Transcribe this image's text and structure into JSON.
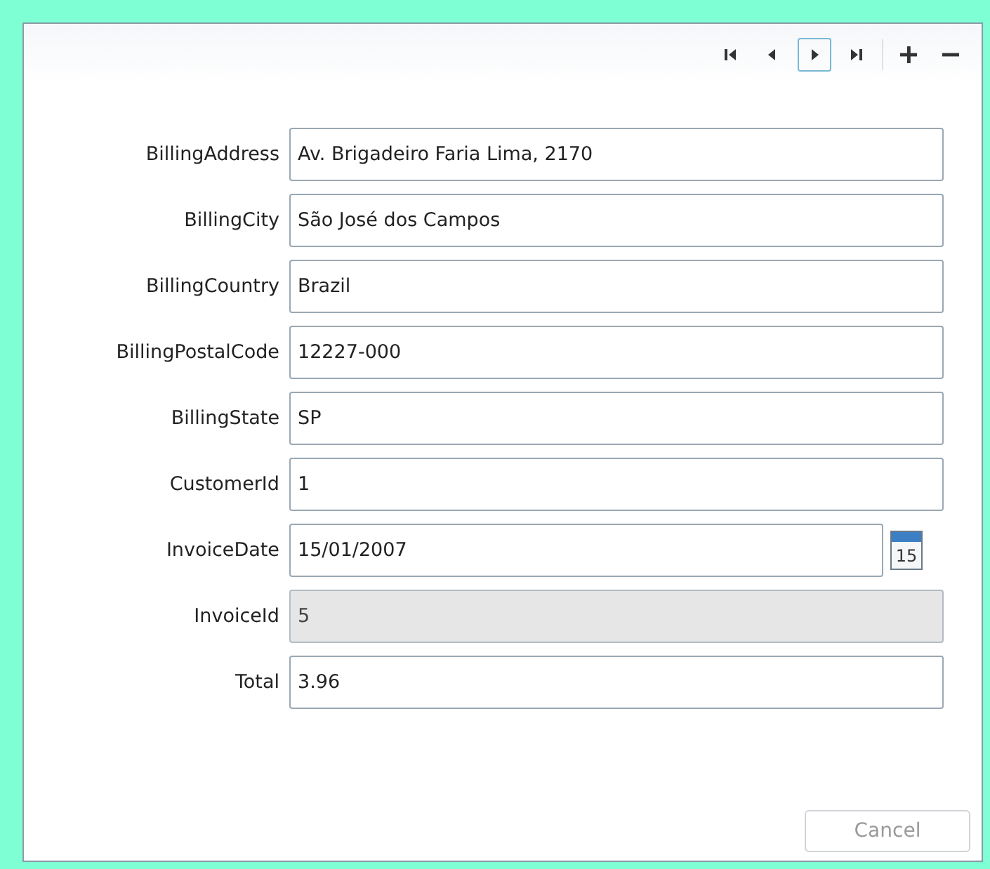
{
  "toolbar": {
    "buttons": [
      {
        "kind": "first",
        "focused": false
      },
      {
        "kind": "previous",
        "focused": false
      },
      {
        "kind": "next",
        "focused": true
      },
      {
        "kind": "last",
        "focused": false
      },
      {
        "kind": "add",
        "focused": false
      },
      {
        "kind": "remove",
        "focused": false
      }
    ]
  },
  "fields": [
    {
      "label": "BillingAddress",
      "value": "Av. Brigadeiro Faria Lima, 2170",
      "kind": "text",
      "disabled": false
    },
    {
      "label": "BillingCity",
      "value": "São José dos Campos",
      "kind": "text",
      "disabled": false
    },
    {
      "label": "BillingCountry",
      "value": "Brazil",
      "kind": "text",
      "disabled": false
    },
    {
      "label": "BillingPostalCode",
      "value": "12227-000",
      "kind": "text",
      "disabled": false
    },
    {
      "label": "BillingState",
      "value": "SP",
      "kind": "text",
      "disabled": false
    },
    {
      "label": "CustomerId",
      "value": "1",
      "kind": "text",
      "disabled": false
    },
    {
      "label": "InvoiceDate",
      "value": "15/01/2007",
      "kind": "date",
      "disabled": false,
      "calendar_day": "15"
    },
    {
      "label": "InvoiceId",
      "value": "5",
      "kind": "text",
      "disabled": true
    },
    {
      "label": "Total",
      "value": "3.96",
      "kind": "text",
      "disabled": false
    }
  ],
  "cancel_button": {
    "label": "Cancel",
    "disabled": true
  }
}
